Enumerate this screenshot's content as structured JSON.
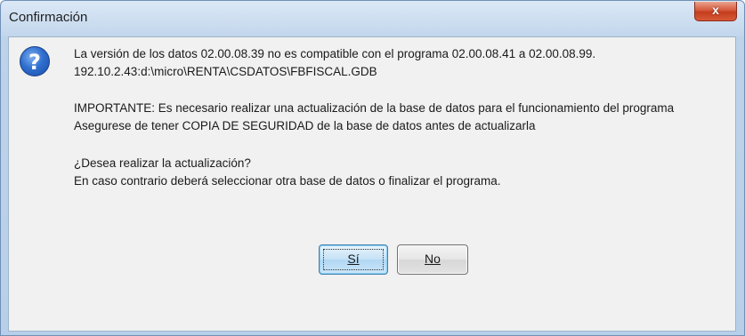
{
  "dialog": {
    "title": "Confirmación",
    "close_label": "x",
    "icon": "question-icon",
    "icon_glyph": "?",
    "message_lines": [
      "La versión de los datos 02.00.08.39 no es compatible con el programa 02.00.08.41 a 02.00.08.99.",
      "192.10.2.43:d:\\micro\\RENTA\\CSDATOS\\FBFISCAL.GDB",
      "IMPORTANTE: Es necesario realizar una actualización de la base de datos para el funcionamiento del programa",
      "Asegurese de tener COPIA DE SEGURIDAD de la base de datos antes de actualizarla",
      "¿Desea realizar la actualización?",
      "En caso contrario deberá seleccionar otra base de datos o finalizar el programa."
    ],
    "buttons": {
      "yes_label": "Sí",
      "no_label": "No"
    },
    "colors": {
      "close_button": "#c9472a",
      "default_button_border": "#3c7fb1",
      "icon_blue": "#2f6fcf"
    }
  }
}
